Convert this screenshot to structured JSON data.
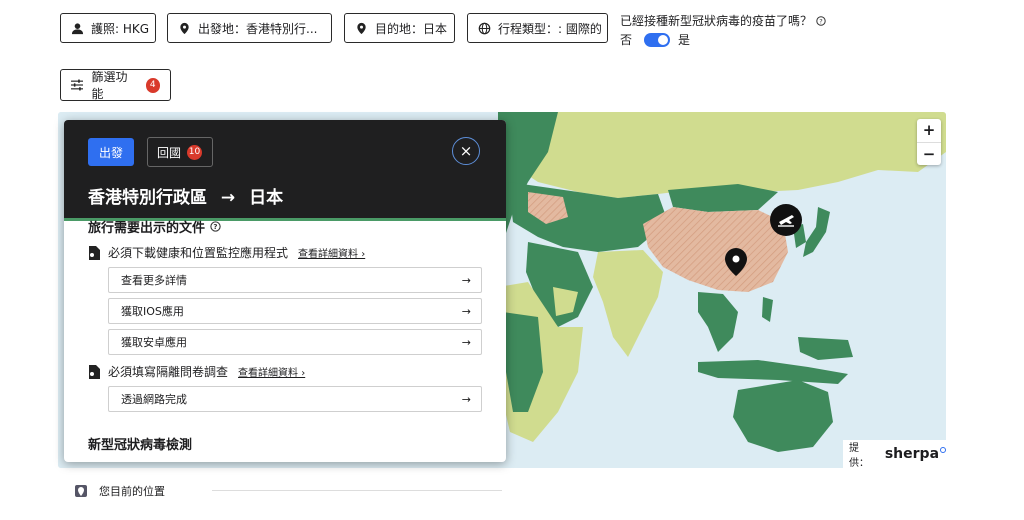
{
  "filters": {
    "passport": "護照: HKG",
    "origin": "出發地：香港特別行...",
    "destination": "目的地：日本",
    "trip_type": "行程類型：: 國際的"
  },
  "vaccination": {
    "question": "已經接種新型冠狀病毒的疫苗了嗎？",
    "no_label": "否",
    "yes_label": "是",
    "toggle_on": true
  },
  "filter_button": {
    "label": "篩選功能",
    "count": "4"
  },
  "panel": {
    "depart_label": "出發",
    "return_label": "回國",
    "return_count": "10",
    "route_from": "香港特別行政區",
    "route_arrow": "→",
    "route_to": "日本",
    "documents_title": "旅行需要出示的文件",
    "requirement1": {
      "text": "必須下載健康和位置監控應用程式",
      "more": "查看詳細資料 ›"
    },
    "options1": [
      "查看更多詳情",
      "獲取IOS應用",
      "獲取安卓應用"
    ],
    "requirement2": {
      "text": "必須填寫隔離問卷調查",
      "more": "查看詳細資料 ›"
    },
    "options2": [
      "透過網路完成"
    ],
    "covid_title": "新型冠狀病毒檢測",
    "option_arrow": "→",
    "close_glyph": "×"
  },
  "map": {
    "zoom_in": "+",
    "zoom_out": "−",
    "attribution_prefix": "提供：",
    "attribution_logo": "sherpa",
    "colors": {
      "sea": "#dcecf3",
      "green": "#3f8a5c",
      "light": "#d0dc8f",
      "restricted": "#e3b9a0"
    }
  },
  "legend": {
    "current_location": "您目前的位置"
  },
  "colors": {
    "accent": "#2f6ff0",
    "badge": "#d93a2b",
    "panel_dark": "#1f1f20"
  }
}
